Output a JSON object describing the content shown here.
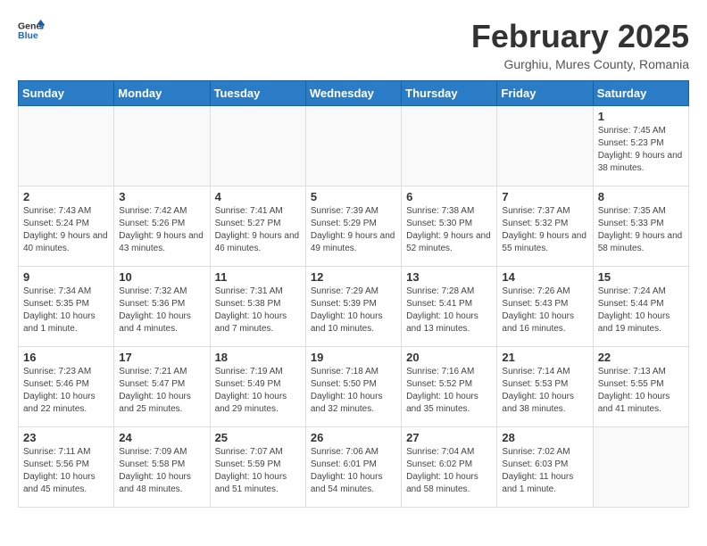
{
  "header": {
    "logo_general": "General",
    "logo_blue": "Blue",
    "month_year": "February 2025",
    "location": "Gurghiu, Mures County, Romania"
  },
  "days_of_week": [
    "Sunday",
    "Monday",
    "Tuesday",
    "Wednesday",
    "Thursday",
    "Friday",
    "Saturday"
  ],
  "weeks": [
    [
      {
        "day": "",
        "info": ""
      },
      {
        "day": "",
        "info": ""
      },
      {
        "day": "",
        "info": ""
      },
      {
        "day": "",
        "info": ""
      },
      {
        "day": "",
        "info": ""
      },
      {
        "day": "",
        "info": ""
      },
      {
        "day": "1",
        "info": "Sunrise: 7:45 AM\nSunset: 5:23 PM\nDaylight: 9 hours and 38 minutes."
      }
    ],
    [
      {
        "day": "2",
        "info": "Sunrise: 7:43 AM\nSunset: 5:24 PM\nDaylight: 9 hours and 40 minutes."
      },
      {
        "day": "3",
        "info": "Sunrise: 7:42 AM\nSunset: 5:26 PM\nDaylight: 9 hours and 43 minutes."
      },
      {
        "day": "4",
        "info": "Sunrise: 7:41 AM\nSunset: 5:27 PM\nDaylight: 9 hours and 46 minutes."
      },
      {
        "day": "5",
        "info": "Sunrise: 7:39 AM\nSunset: 5:29 PM\nDaylight: 9 hours and 49 minutes."
      },
      {
        "day": "6",
        "info": "Sunrise: 7:38 AM\nSunset: 5:30 PM\nDaylight: 9 hours and 52 minutes."
      },
      {
        "day": "7",
        "info": "Sunrise: 7:37 AM\nSunset: 5:32 PM\nDaylight: 9 hours and 55 minutes."
      },
      {
        "day": "8",
        "info": "Sunrise: 7:35 AM\nSunset: 5:33 PM\nDaylight: 9 hours and 58 minutes."
      }
    ],
    [
      {
        "day": "9",
        "info": "Sunrise: 7:34 AM\nSunset: 5:35 PM\nDaylight: 10 hours and 1 minute."
      },
      {
        "day": "10",
        "info": "Sunrise: 7:32 AM\nSunset: 5:36 PM\nDaylight: 10 hours and 4 minutes."
      },
      {
        "day": "11",
        "info": "Sunrise: 7:31 AM\nSunset: 5:38 PM\nDaylight: 10 hours and 7 minutes."
      },
      {
        "day": "12",
        "info": "Sunrise: 7:29 AM\nSunset: 5:39 PM\nDaylight: 10 hours and 10 minutes."
      },
      {
        "day": "13",
        "info": "Sunrise: 7:28 AM\nSunset: 5:41 PM\nDaylight: 10 hours and 13 minutes."
      },
      {
        "day": "14",
        "info": "Sunrise: 7:26 AM\nSunset: 5:43 PM\nDaylight: 10 hours and 16 minutes."
      },
      {
        "day": "15",
        "info": "Sunrise: 7:24 AM\nSunset: 5:44 PM\nDaylight: 10 hours and 19 minutes."
      }
    ],
    [
      {
        "day": "16",
        "info": "Sunrise: 7:23 AM\nSunset: 5:46 PM\nDaylight: 10 hours and 22 minutes."
      },
      {
        "day": "17",
        "info": "Sunrise: 7:21 AM\nSunset: 5:47 PM\nDaylight: 10 hours and 25 minutes."
      },
      {
        "day": "18",
        "info": "Sunrise: 7:19 AM\nSunset: 5:49 PM\nDaylight: 10 hours and 29 minutes."
      },
      {
        "day": "19",
        "info": "Sunrise: 7:18 AM\nSunset: 5:50 PM\nDaylight: 10 hours and 32 minutes."
      },
      {
        "day": "20",
        "info": "Sunrise: 7:16 AM\nSunset: 5:52 PM\nDaylight: 10 hours and 35 minutes."
      },
      {
        "day": "21",
        "info": "Sunrise: 7:14 AM\nSunset: 5:53 PM\nDaylight: 10 hours and 38 minutes."
      },
      {
        "day": "22",
        "info": "Sunrise: 7:13 AM\nSunset: 5:55 PM\nDaylight: 10 hours and 41 minutes."
      }
    ],
    [
      {
        "day": "23",
        "info": "Sunrise: 7:11 AM\nSunset: 5:56 PM\nDaylight: 10 hours and 45 minutes."
      },
      {
        "day": "24",
        "info": "Sunrise: 7:09 AM\nSunset: 5:58 PM\nDaylight: 10 hours and 48 minutes."
      },
      {
        "day": "25",
        "info": "Sunrise: 7:07 AM\nSunset: 5:59 PM\nDaylight: 10 hours and 51 minutes."
      },
      {
        "day": "26",
        "info": "Sunrise: 7:06 AM\nSunset: 6:01 PM\nDaylight: 10 hours and 54 minutes."
      },
      {
        "day": "27",
        "info": "Sunrise: 7:04 AM\nSunset: 6:02 PM\nDaylight: 10 hours and 58 minutes."
      },
      {
        "day": "28",
        "info": "Sunrise: 7:02 AM\nSunset: 6:03 PM\nDaylight: 11 hours and 1 minute."
      },
      {
        "day": "",
        "info": ""
      }
    ]
  ]
}
